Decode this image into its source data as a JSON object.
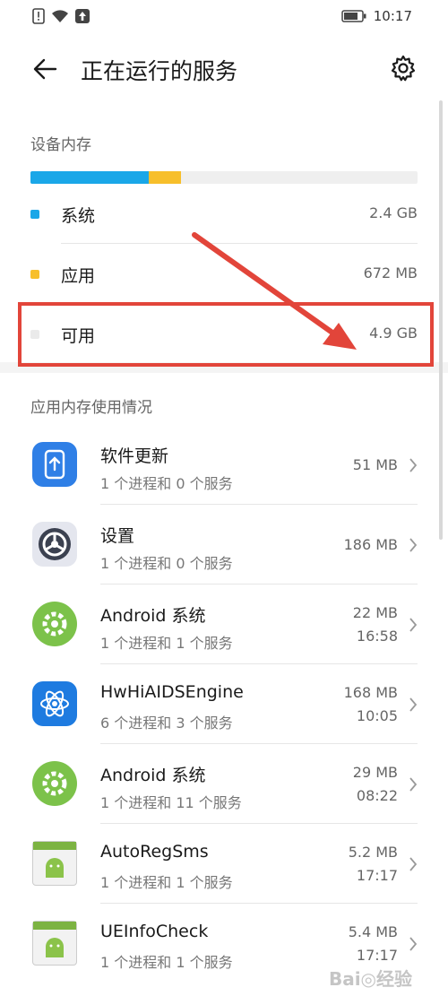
{
  "status_bar": {
    "time": "10:17"
  },
  "app_bar": {
    "title": "正在运行的服务"
  },
  "device_memory": {
    "section_title": "设备内存",
    "bar": {
      "system_fraction": 0.305,
      "app_fraction": 0.083
    },
    "rows": [
      {
        "label": "系统",
        "value": "2.4 GB",
        "color": "#1aa7e8"
      },
      {
        "label": "应用",
        "value": "672 MB",
        "color": "#f7bf2b"
      },
      {
        "label": "可用",
        "value": "4.9 GB",
        "color": "#efefef"
      }
    ]
  },
  "app_memory": {
    "section_title": "应用内存使用情况",
    "apps": [
      {
        "name": "软件更新",
        "sub": "1 个进程和 0 个服务",
        "size": "51 MB",
        "time": "",
        "icon": "software-update-icon"
      },
      {
        "name": "设置",
        "sub": "1 个进程和 0 个服务",
        "size": "186 MB",
        "time": "",
        "icon": "settings-icon"
      },
      {
        "name": "Android 系统",
        "sub": "1 个进程和 1 个服务",
        "size": "22 MB",
        "time": "16:58",
        "icon": "android-system-icon"
      },
      {
        "name": "HwHiAIDSEngine",
        "sub": "6 个进程和 3 个服务",
        "size": "168 MB",
        "time": "10:05",
        "icon": "atom-icon"
      },
      {
        "name": "Android 系统",
        "sub": "1 个进程和 11 个服务",
        "size": "29 MB",
        "time": "08:22",
        "icon": "android-system-icon"
      },
      {
        "name": "AutoRegSms",
        "sub": "1 个进程和 1 个服务",
        "size": "5.2 MB",
        "time": "17:17",
        "icon": "android-app-icon"
      },
      {
        "name": "UEInfoCheck",
        "sub": "1 个进程和 1 个服务",
        "size": "5.4 MB",
        "time": "17:17",
        "icon": "android-app-icon"
      }
    ]
  },
  "annotation": {
    "color": "#e2453a"
  }
}
